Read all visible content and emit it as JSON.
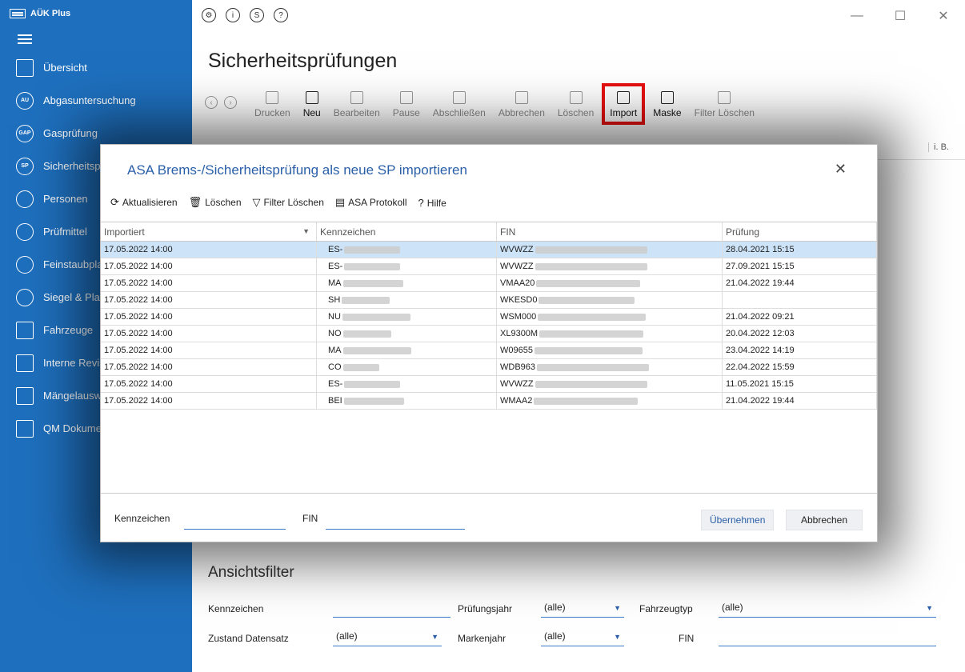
{
  "app": {
    "title": "AÜK Plus"
  },
  "sidebar": {
    "items": [
      {
        "label": "Übersicht",
        "icon": "home-icon",
        "iconText": ""
      },
      {
        "label": "Abgasuntersuchung",
        "icon": "au-icon",
        "iconText": "AU"
      },
      {
        "label": "Gasprüfung",
        "icon": "gap-icon",
        "iconText": "GAP"
      },
      {
        "label": "Sicherheitsprüfungen",
        "icon": "sp-icon",
        "iconText": "SP"
      },
      {
        "label": "Personen",
        "icon": "people-icon",
        "iconText": ""
      },
      {
        "label": "Prüfmittel",
        "icon": "ruler-icon",
        "iconText": ""
      },
      {
        "label": "Feinstaubplakette",
        "icon": "sticker-icon",
        "iconText": ""
      },
      {
        "label": "Siegel & Plaketten",
        "icon": "seal-icon",
        "iconText": ""
      },
      {
        "label": "Fahrzeuge",
        "icon": "car-icon",
        "iconText": ""
      },
      {
        "label": "Interne Revision",
        "icon": "clipboard-icon",
        "iconText": ""
      },
      {
        "label": "Mängelauswertung",
        "icon": "pie-chart-icon",
        "iconText": ""
      },
      {
        "label": "QM Dokumente",
        "icon": "book-icon",
        "iconText": ""
      }
    ]
  },
  "main": {
    "title": "Sicherheitsprüfungen",
    "toolbar": [
      {
        "label": "Drucken",
        "active": false
      },
      {
        "label": "Neu",
        "active": true
      },
      {
        "label": "Bearbeiten",
        "active": false
      },
      {
        "label": "Pause",
        "active": false
      },
      {
        "label": "Abschließen",
        "active": false
      },
      {
        "label": "Abbrechen",
        "active": false
      },
      {
        "label": "Löschen",
        "active": false
      },
      {
        "label": "Import",
        "active": true,
        "highlight": true
      },
      {
        "label": "Maske",
        "active": true
      },
      {
        "label": "Filter Löschen",
        "active": false
      }
    ],
    "grid_col_ib": "i. B.",
    "filter": {
      "title": "Ansichtsfilter",
      "kennzeichen_label": "Kennzeichen",
      "zustand_label": "Zustand Datensatz",
      "zustand_value": "(alle)",
      "pruefungsjahr_label": "Prüfungsjahr",
      "pruefungsjahr_value": "(alle)",
      "markenjahr_label": "Markenjahr",
      "markenjahr_value": "(alle)",
      "fahrzeugtyp_label": "Fahrzeugtyp",
      "fahrzeugtyp_value": "(alle)",
      "fin_label": "FIN"
    }
  },
  "dialog": {
    "title": "ASA Brems-/Sicherheitsprüfung als neue SP importieren",
    "toolbar": {
      "refresh": "Aktualisieren",
      "delete": "Löschen",
      "filter_clear": "Filter Löschen",
      "protocol": "ASA Protokoll",
      "help": "Hilfe"
    },
    "columns": [
      "Importiert",
      "Kennzeichen",
      "FIN",
      "Prüfung"
    ],
    "rows": [
      {
        "imported": "17.05.2022 14:00",
        "plate": "ES-",
        "fin": "WVWZZ",
        "check": "28.04.2021 15:15",
        "selected": true
      },
      {
        "imported": "17.05.2022 14:00",
        "plate": "ES-",
        "fin": "WVWZZ",
        "check": "27.09.2021 15:15"
      },
      {
        "imported": "17.05.2022 14:00",
        "plate": "MA",
        "fin": "VMAA20",
        "check": "21.04.2022 19:44"
      },
      {
        "imported": "17.05.2022 14:00",
        "plate": "SH",
        "fin": "WKESD0",
        "check": ""
      },
      {
        "imported": "17.05.2022 14:00",
        "plate": "NU",
        "fin": "WSM000",
        "check": "21.04.2022 09:21"
      },
      {
        "imported": "17.05.2022 14:00",
        "plate": "NO",
        "fin": "XL9300M",
        "check": "20.04.2022 12:03"
      },
      {
        "imported": "17.05.2022 14:00",
        "plate": "MA",
        "fin": "W09655",
        "check": "23.04.2022 14:19"
      },
      {
        "imported": "17.05.2022 14:00",
        "plate": "CO",
        "fin": "WDB963",
        "check": "22.04.2022 15:59"
      },
      {
        "imported": "17.05.2022 14:00",
        "plate": "ES-",
        "fin": "WVWZZ",
        "check": "11.05.2021 15:15"
      },
      {
        "imported": "17.05.2022 14:00",
        "plate": "BEI",
        "fin": "WMAA2",
        "check": "21.04.2022 19:44"
      }
    ],
    "footer": {
      "kennzeichen_label": "Kennzeichen",
      "fin_label": "FIN",
      "accept": "Übernehmen",
      "cancel": "Abbrechen"
    }
  },
  "colors": {
    "sidebar": "#1e6fbd",
    "accent": "#2a5fa8",
    "highlight": "#e81010",
    "selected_row": "#cde3f7"
  }
}
